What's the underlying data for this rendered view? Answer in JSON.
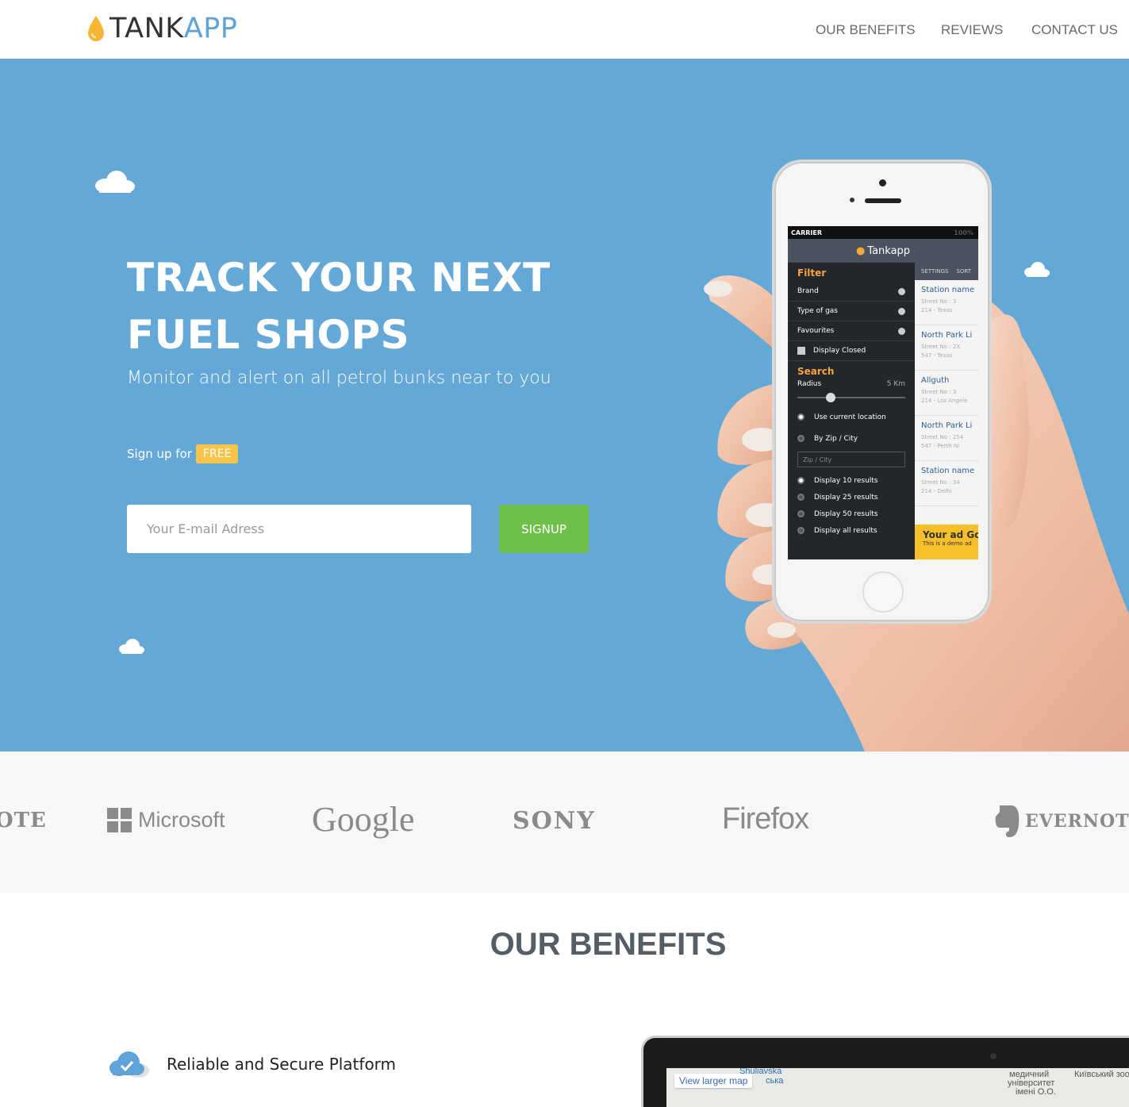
{
  "header": {
    "logo_part1": "TANK",
    "logo_part2": "APP",
    "nav": [
      "OUR BENEFITS",
      "REVIEWS",
      "CONTACT US"
    ]
  },
  "hero": {
    "title_line1": "TRACK YOUR NEXT",
    "title_line2": "FUEL SHOPS",
    "subtitle": "Monitor and alert on all petrol bunks near to you",
    "signup_prefix": "Sign up for",
    "free_badge": "FREE",
    "email_placeholder": "Your E-mail Adress",
    "signup_button": "SIGNUP"
  },
  "phone": {
    "carrier": "CARRIER",
    "battery": "100%",
    "app_name": "Tankapp",
    "filter_heading": "Filter",
    "filter_rows": [
      "Brand",
      "Type of gas",
      "Favourites"
    ],
    "display_closed": "Display Closed",
    "search_heading": "Search",
    "radius_label": "Radius",
    "radius_value": "5 Km",
    "location_options": [
      "Use current location",
      "By Zip / City"
    ],
    "zip_placeholder": "Zip / City",
    "result_options": [
      "Display 10 results",
      "Display 25 results",
      "Display 50 results",
      "Display all results"
    ],
    "tabs": [
      "SETTINGS",
      "SORT"
    ],
    "stations": [
      {
        "name": "Station name",
        "line1": "Street No : 3",
        "line2": "214 - Texas"
      },
      {
        "name": "North Park Li",
        "line1": "Street No : 2X",
        "line2": "547 - Texas"
      },
      {
        "name": "Allguth",
        "line1": "Street No : 3",
        "line2": "214 - Los Angele"
      },
      {
        "name": "North Park Li",
        "line1": "Street No : 254",
        "line2": "547 - Perth Ni"
      },
      {
        "name": "Station name",
        "line1": "Street No : 34",
        "line2": "214 - Delhi"
      }
    ],
    "ad_title": "Your ad Go",
    "ad_sub": "This is a demo ad"
  },
  "brands": [
    "OTE",
    "Microsoft",
    "Google",
    "SONY",
    "Firefox",
    "EVERNOTE"
  ],
  "benefits": {
    "title": "OUR BENEFITS",
    "items": [
      "Reliable and Secure Platform"
    ],
    "map_link": "View larger map",
    "map_labels": [
      "Shuliavska",
      "ська",
      "медичний",
      "університет",
      "імені О.О.",
      "Київський зоо"
    ]
  },
  "colors": {
    "hero_bg": "#63a8d7",
    "accent_blue": "#5fa4d8",
    "signup_green": "#6ec04b",
    "free_yellow": "#f8c44a",
    "logo_drop": "#f5b731"
  }
}
